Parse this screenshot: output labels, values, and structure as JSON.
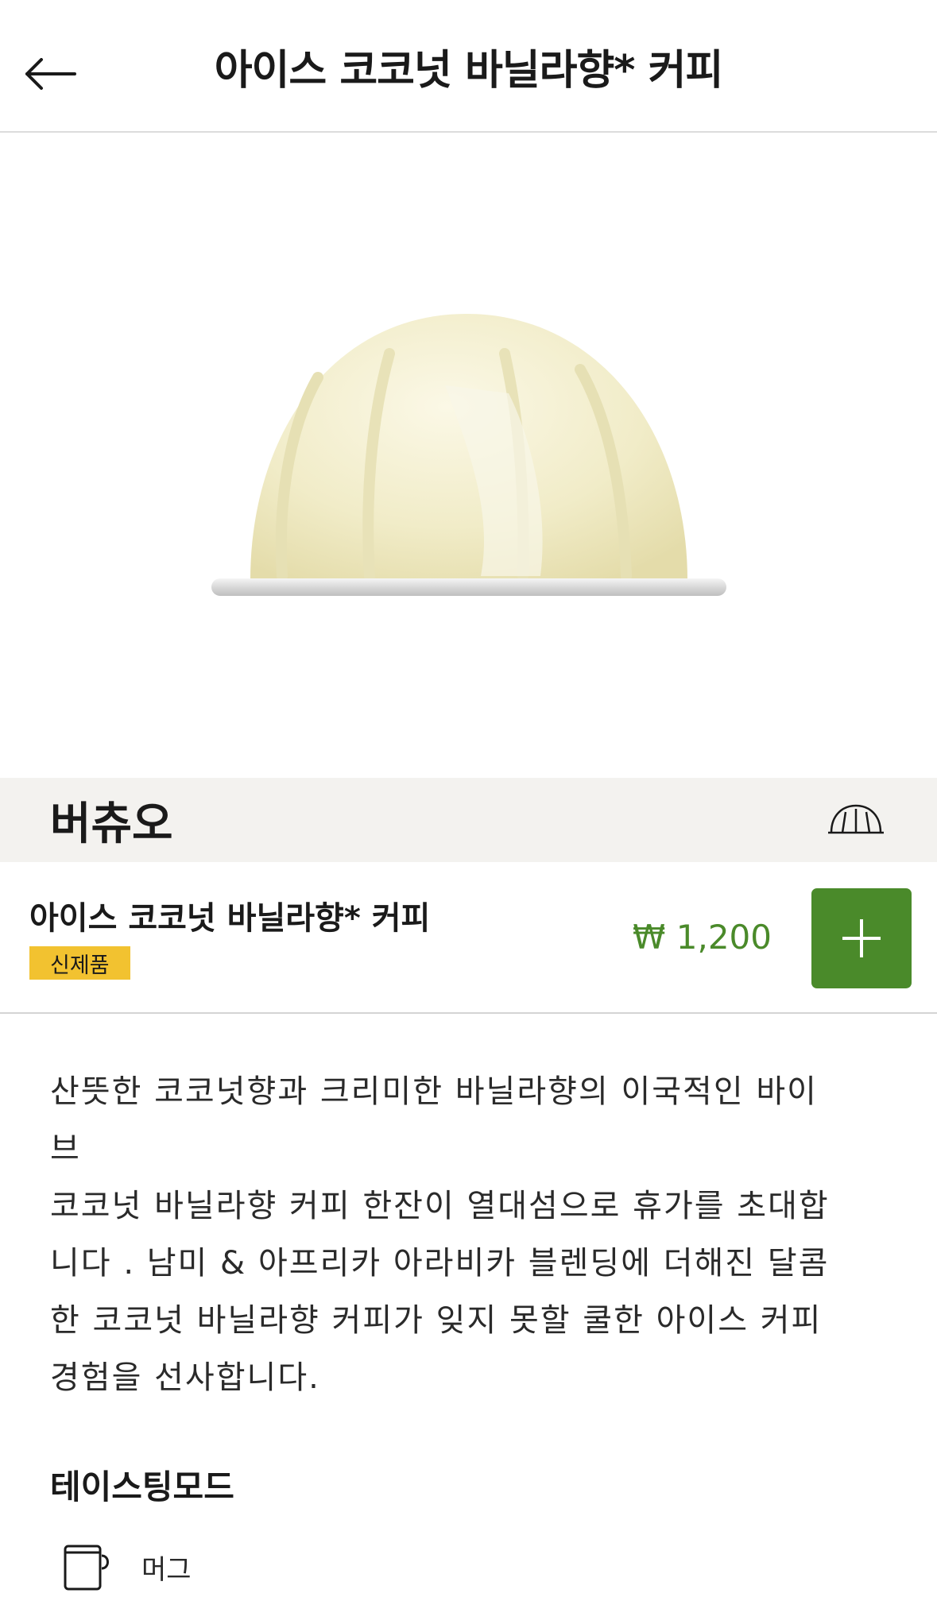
{
  "header": {
    "title": "아이스 코코넛 바닐라향* 커피"
  },
  "category": {
    "label": "버츄오",
    "icon": "vertuo-capsule-icon"
  },
  "product": {
    "name": "아이스 코코넛 바닐라향* 커피",
    "badge": "신제품",
    "price": "₩ 1,200",
    "price_color": "#4a8a2a",
    "badge_color": "#f2c230",
    "add_button_color": "#4a8a2a"
  },
  "description": "산뜻한 코코넛향과 크리미한 바닐라향의 이국적인 바이\n브\n코코넛 바닐라향 커피 한잔이 열대섬으로 휴가를 초대합\n니다 . 남미 & 아프리카 아라비카 블렌딩에 더해진 달콤\n한 코코넛 바닐라향 커피가 잊지 못할 쿨한 아이스 커피\n경험을 선사합니다.",
  "tasting": {
    "title": "테이스팅모드",
    "modes": [
      {
        "label": "머그",
        "icon": "mug-icon"
      }
    ]
  }
}
